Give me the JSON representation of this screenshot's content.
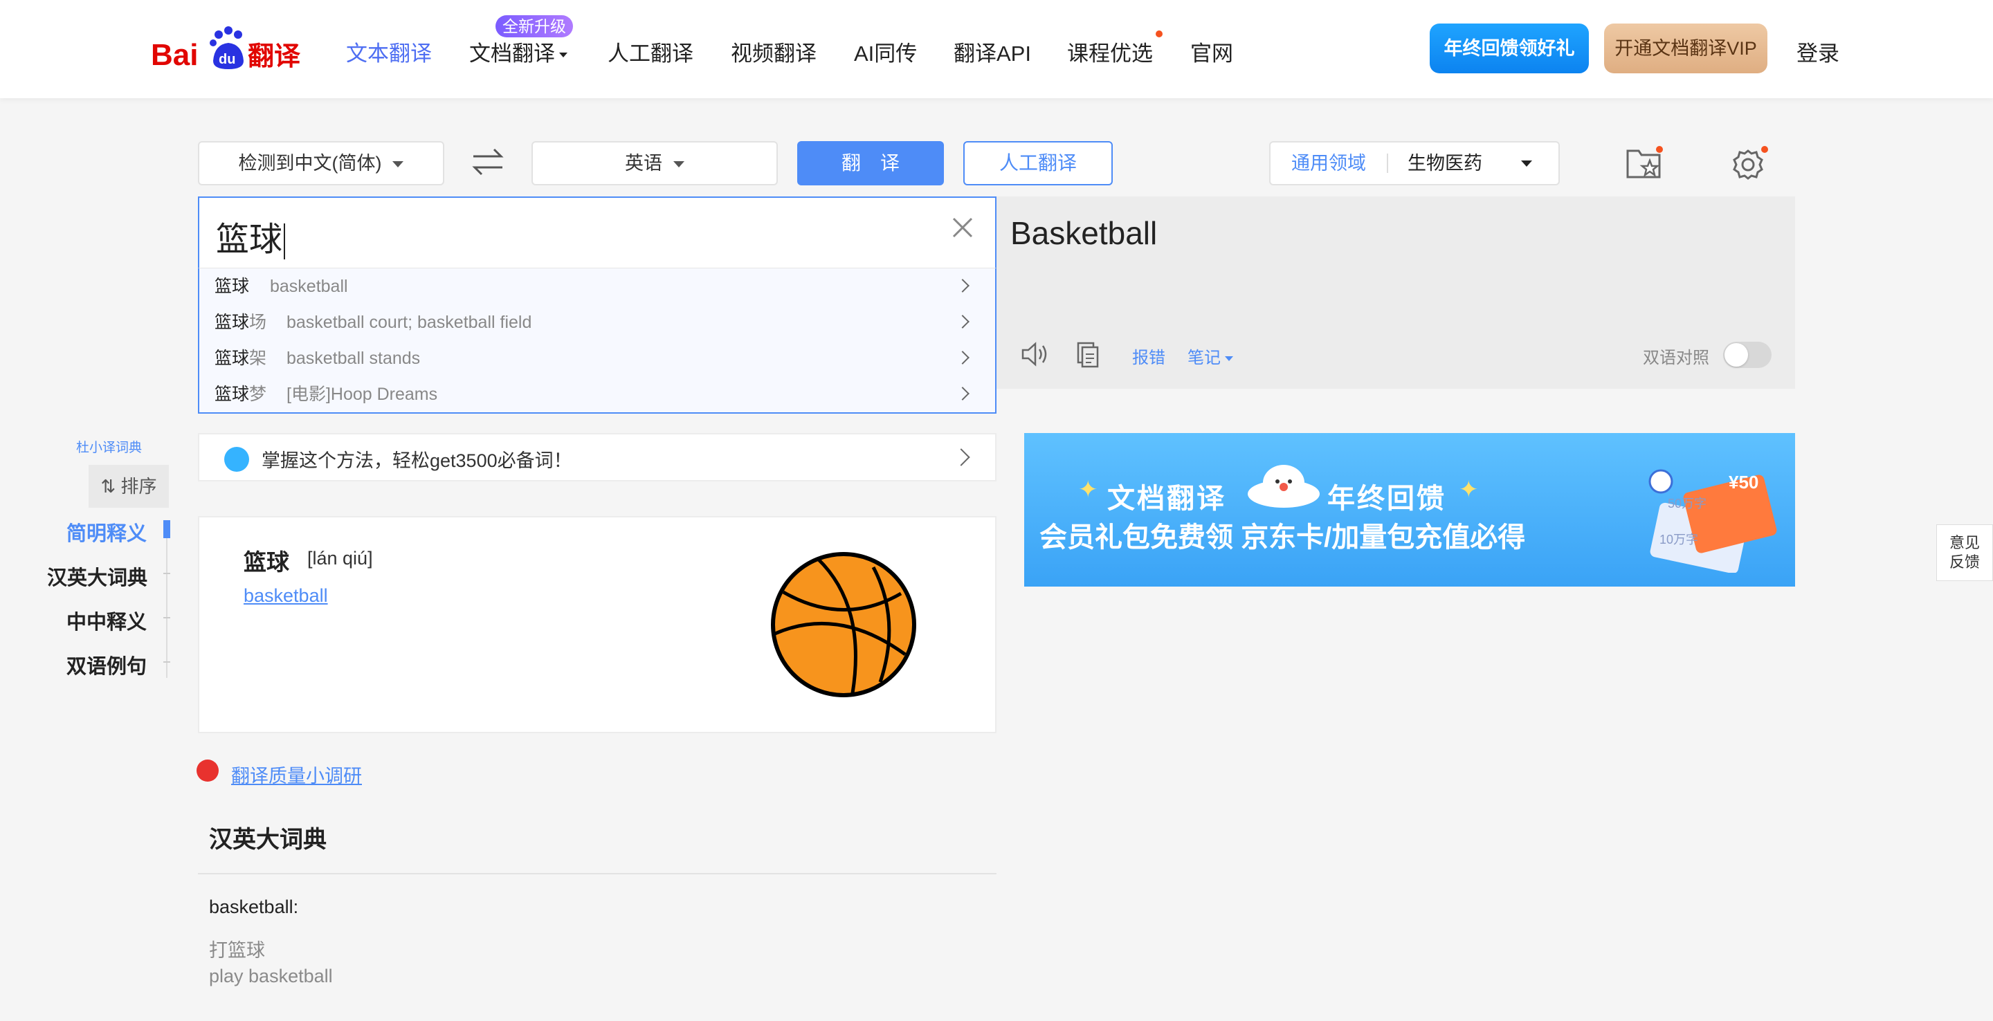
{
  "header": {
    "logo_text": "Bai du 翻译",
    "nav": [
      "文本翻译",
      "文档翻译",
      "人工翻译",
      "视频翻译",
      "AI同传",
      "翻译API",
      "课程优选",
      "官网"
    ],
    "new_badge": "全新升级",
    "gift_button": "年终回馈领好礼",
    "vip_button": "开通文档翻译VIP",
    "login": "登录"
  },
  "toolbar": {
    "source_lang": "检测到中文(简体)",
    "target_lang": "英语",
    "translate_button": "翻译",
    "human_button": "人工翻译",
    "domain_label": "通用领域",
    "domain_value": "生物医药"
  },
  "input": {
    "text": "篮球",
    "suggestions": [
      {
        "head": "篮球",
        "rest": "",
        "def": "basketball"
      },
      {
        "head": "篮球",
        "rest": "场",
        "def": "basketball court; basketball field"
      },
      {
        "head": "篮球",
        "rest": "架",
        "def": "basketball stands"
      },
      {
        "head": "篮球",
        "rest": "梦",
        "def": "[电影]Hoop Dreams"
      }
    ]
  },
  "output": {
    "text": "Basketball",
    "report": "报错",
    "notes": "笔记",
    "bilingual": "双语对照"
  },
  "promo": {
    "text": "掌握这个方法，轻松get3500必备词！"
  },
  "dict": {
    "word": "篮球",
    "pinyin": "[lán qiú]",
    "translation": "basketball"
  },
  "survey": "翻译质量小调研",
  "big_dict": {
    "title": "汉英大词典",
    "headword": "basketball:",
    "example_zh": "打篮球",
    "example_en": "play basketball"
  },
  "ad": {
    "line1a": "文档翻译",
    "line1b": "年终回馈",
    "line2": "会员礼包免费领  京东卡/加量包充值必得",
    "ticket1": "50万字",
    "ticket2": "10万字",
    "coupon": "¥50"
  },
  "sidebar": {
    "small_label": "杜小译词典",
    "sort": "排序",
    "items": [
      "简明释义",
      "汉英大词典",
      "中中释义",
      "双语例句"
    ]
  },
  "feedback": [
    "意见",
    "反馈"
  ],
  "colors": {
    "accent": "#4e8cf7",
    "gift": "#0c83f0",
    "vip": "#dfae82"
  }
}
